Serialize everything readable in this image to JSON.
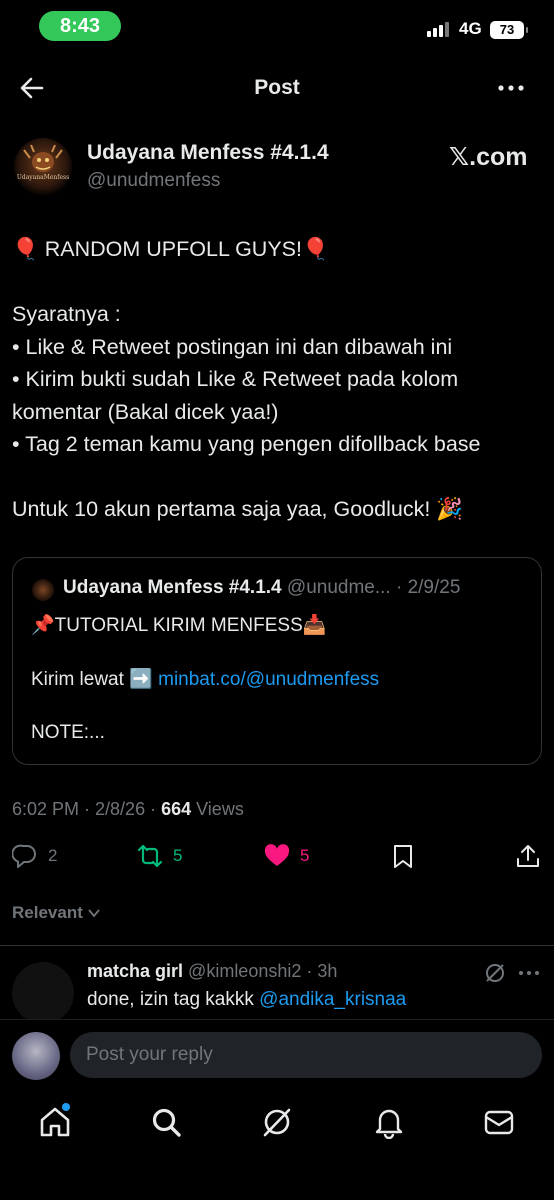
{
  "status_bar": {
    "time": "8:43",
    "network": "4G",
    "battery": "73"
  },
  "header": {
    "title": "Post"
  },
  "author": {
    "name": "Udayana Menfess #4.1.4",
    "handle": "@unudmenfess",
    "avatar_text": "UdayanaMenfess"
  },
  "watermark": "𝕏.com",
  "post": {
    "lines": [
      "🎈 RANDOM UPFOLL GUYS!🎈",
      "",
      "Syaratnya :",
      "• Like & Retweet postingan ini dan dibawah ini",
      "• Kirim bukti sudah Like & Retweet pada kolom",
      "komentar (Bakal dicek yaa!)",
      "• Tag 2 teman kamu yang pengen difollback base",
      "",
      "Untuk 10 akun pertama saja yaa, Goodluck! 🎉"
    ]
  },
  "quote": {
    "name": "Udayana Menfess #4.1.4",
    "handle": "@unudme... · 2/9/25",
    "line1": "📌TUTORIAL KIRIM MENFESS📥",
    "line2_prefix": "Kirim lewat ➡️ ",
    "line2_link": "minbat.co/@unudmenfess",
    "line3": "NOTE:..."
  },
  "meta": {
    "time_date": "6:02 PM · 2/8/26 · ",
    "views_count": "664",
    "views_label": " Views"
  },
  "actions": {
    "replies": "2",
    "reposts": "5",
    "likes": "5"
  },
  "sort": {
    "label": "Relevant"
  },
  "reply": {
    "name": "matcha girl",
    "handle": "@kimleonshi2 · 3h",
    "text_prefix": "done, izin tag kakkk ",
    "mention": "@andika_krisnaa"
  },
  "reply_bar": {
    "placeholder": "Post your reply"
  },
  "colors": {
    "accent": "#1d9bf0",
    "like": "#f91880",
    "repost": "#00ba7c",
    "muted": "#71767b"
  },
  "icons": [
    "back-icon",
    "more-icon",
    "reply-icon",
    "repost-icon",
    "like-icon",
    "bookmark-icon",
    "share-icon",
    "chevron-down-icon",
    "grok-icon",
    "home-icon",
    "search-icon",
    "bell-icon",
    "mail-icon"
  ]
}
